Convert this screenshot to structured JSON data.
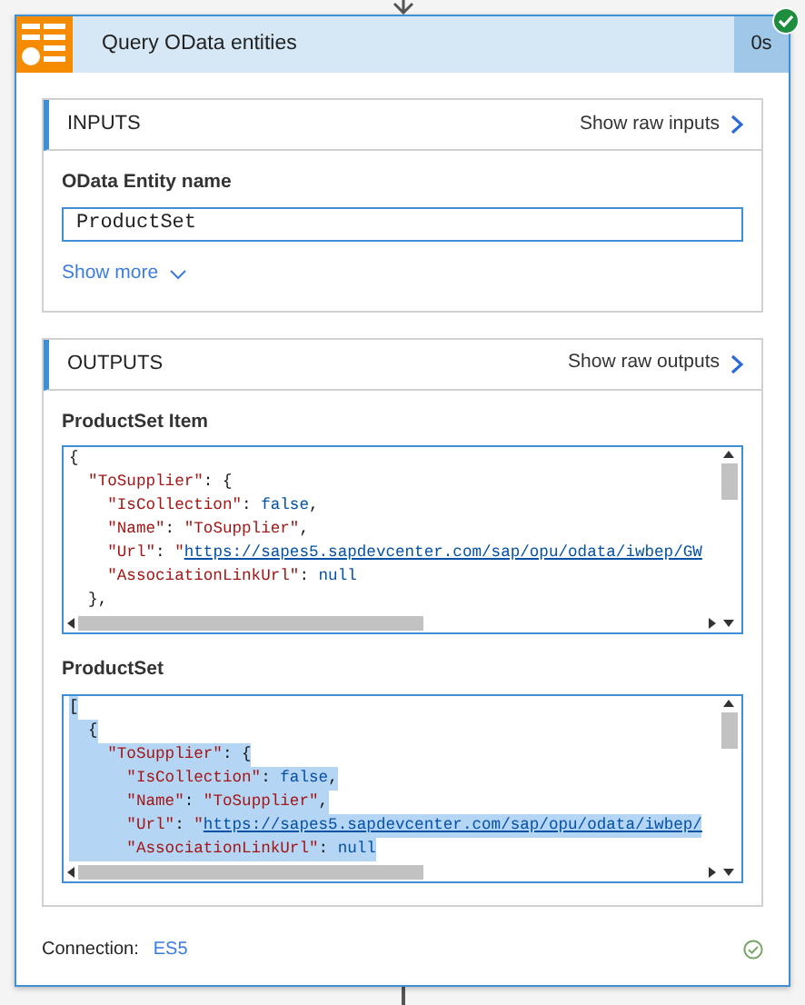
{
  "action": {
    "title": "Query OData entities",
    "duration": "0s",
    "succeeded": true
  },
  "inputs": {
    "heading": "INPUTS",
    "raw_link": "Show raw inputs",
    "fields": [
      {
        "label": "OData Entity name",
        "value": "ProductSet"
      }
    ],
    "show_more": "Show more"
  },
  "outputs": {
    "heading": "OUTPUTS",
    "raw_link": "Show raw outputs",
    "fields": [
      {
        "label": "ProductSet Item",
        "selected": false,
        "lines": [
          [
            {
              "kind": "punct",
              "text": "{"
            }
          ],
          [
            {
              "kind": "key",
              "text": "  \"ToSupplier\""
            },
            {
              "kind": "punct",
              "text": ": {"
            }
          ],
          [
            {
              "kind": "key",
              "text": "    \"IsCollection\""
            },
            {
              "kind": "punct",
              "text": ": "
            },
            {
              "kind": "literal",
              "text": "false"
            },
            {
              "kind": "punct",
              "text": ","
            }
          ],
          [
            {
              "kind": "key",
              "text": "    \"Name\""
            },
            {
              "kind": "punct",
              "text": ": "
            },
            {
              "kind": "string",
              "text": "\"ToSupplier\""
            },
            {
              "kind": "punct",
              "text": ","
            }
          ],
          [
            {
              "kind": "key",
              "text": "    \"Url\""
            },
            {
              "kind": "punct",
              "text": ": "
            },
            {
              "kind": "string",
              "text": "\""
            },
            {
              "kind": "link",
              "text": "https://sapes5.sapdevcenter.com/sap/opu/odata/iwbep/GW"
            }
          ],
          [
            {
              "kind": "key",
              "text": "    \"AssociationLinkUrl\""
            },
            {
              "kind": "punct",
              "text": ": "
            },
            {
              "kind": "literal",
              "text": "null"
            }
          ],
          [
            {
              "kind": "punct",
              "text": "  },"
            }
          ]
        ]
      },
      {
        "label": "ProductSet",
        "selected": true,
        "lines": [
          [
            {
              "kind": "punct",
              "text": "["
            }
          ],
          [
            {
              "kind": "punct",
              "text": "  {"
            }
          ],
          [
            {
              "kind": "key",
              "text": "    \"ToSupplier\""
            },
            {
              "kind": "punct",
              "text": ": {"
            }
          ],
          [
            {
              "kind": "key",
              "text": "      \"IsCollection\""
            },
            {
              "kind": "punct",
              "text": ": "
            },
            {
              "kind": "literal",
              "text": "false"
            },
            {
              "kind": "punct",
              "text": ","
            }
          ],
          [
            {
              "kind": "key",
              "text": "      \"Name\""
            },
            {
              "kind": "punct",
              "text": ": "
            },
            {
              "kind": "string",
              "text": "\"ToSupplier\""
            },
            {
              "kind": "punct",
              "text": ","
            }
          ],
          [
            {
              "kind": "key",
              "text": "      \"Url\""
            },
            {
              "kind": "punct",
              "text": ": "
            },
            {
              "kind": "string",
              "text": "\""
            },
            {
              "kind": "link",
              "text": "https://sapes5.sapdevcenter.com/sap/opu/odata/iwbep/"
            }
          ],
          [
            {
              "kind": "key",
              "text": "      \"AssociationLinkUrl\""
            },
            {
              "kind": "punct",
              "text": ": "
            },
            {
              "kind": "literal",
              "text": "null"
            }
          ]
        ]
      }
    ]
  },
  "connection": {
    "label": "Connection:",
    "value": "ES5",
    "valid": true
  }
}
